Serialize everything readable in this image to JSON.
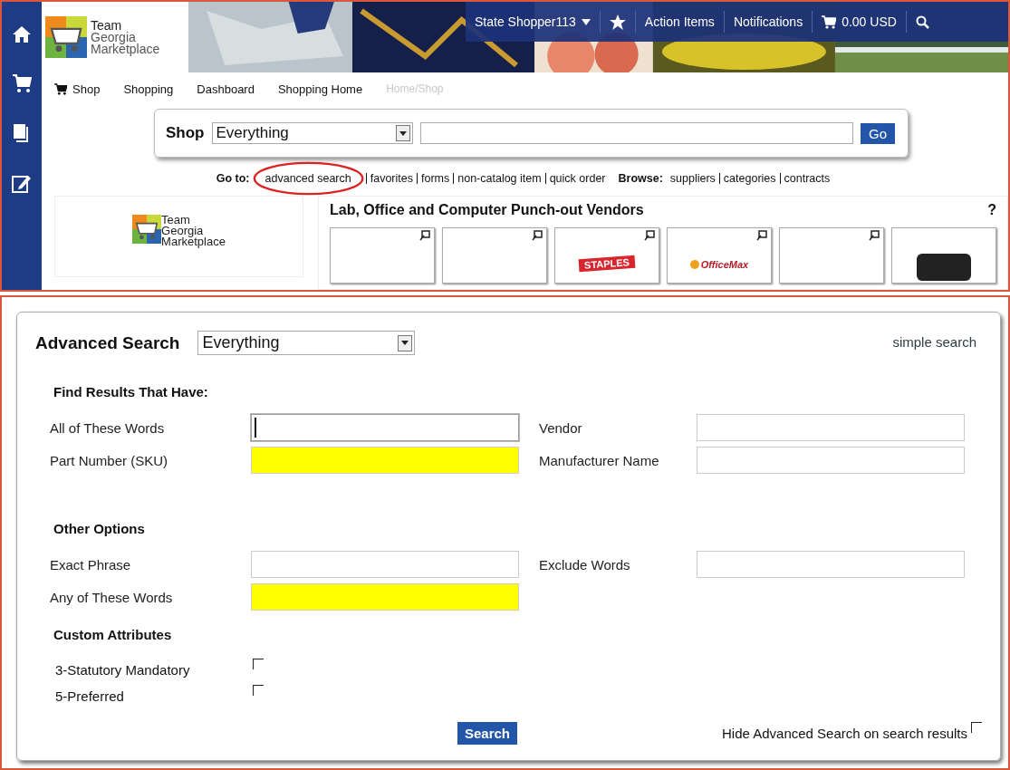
{
  "header": {
    "logo": {
      "line_1": "Team",
      "line_2": "Georgia",
      "line_3": "Marketplace"
    },
    "user_menu": "State Shopper113",
    "links": [
      "Action Items",
      "Notifications"
    ],
    "cart_total": "0.00 USD"
  },
  "nav": {
    "items": [
      "Shop",
      "Shopping",
      "Dashboard",
      "Shopping Home"
    ],
    "breadcrumb": "Home/Shop"
  },
  "shop_search": {
    "label": "Shop",
    "scope": "Everything",
    "button": "Go"
  },
  "go_to": {
    "label": "Go to:",
    "links": [
      "advanced search",
      "favorites",
      "forms",
      "non-catalog item",
      "quick order"
    ],
    "browse_label": "Browse:",
    "browse_links": [
      "suppliers",
      "categories",
      "contracts"
    ]
  },
  "promo_logo": {
    "line_1": "Team",
    "line_2": "Georgia",
    "line_3": "Marketplace"
  },
  "vendors": {
    "title": "Lab, Office and Computer Punch-out Vendors",
    "help": "?",
    "tiles": [
      {
        "kind": "blank"
      },
      {
        "kind": "blank"
      },
      {
        "kind": "staples",
        "label": "STAPLES"
      },
      {
        "kind": "officemax",
        "label": "OfficeMax"
      },
      {
        "kind": "blank"
      },
      {
        "kind": "dark"
      }
    ]
  },
  "advanced_search": {
    "title": "Advanced Search",
    "scope": "Everything",
    "simple_link": "simple search",
    "sections": [
      {
        "heading": "Find Results That Have:",
        "fields": [
          {
            "label": "All of These Words",
            "highlighted": false,
            "focused": true
          },
          {
            "label": "Vendor",
            "highlighted": false,
            "focused": false
          },
          {
            "label": "Part Number (SKU)",
            "highlighted": true,
            "focused": false
          },
          {
            "label": "Manufacturer Name",
            "highlighted": false,
            "focused": false
          }
        ]
      },
      {
        "heading": "Other Options",
        "fields": [
          {
            "label": "Exact Phrase",
            "highlighted": false,
            "focused": false
          },
          {
            "label": "Exclude Words",
            "highlighted": false,
            "focused": false
          },
          {
            "label": "Any of These Words",
            "highlighted": true,
            "focused": false
          }
        ]
      }
    ],
    "custom_attributes": {
      "heading": "Custom Attributes",
      "options": [
        {
          "label": "3-Statutory Mandatory",
          "checked": false
        },
        {
          "label": "5-Preferred",
          "checked": false
        }
      ]
    },
    "search_button": "Search",
    "hide_option": {
      "label": "Hide Advanced Search on search results",
      "checked": false
    }
  }
}
